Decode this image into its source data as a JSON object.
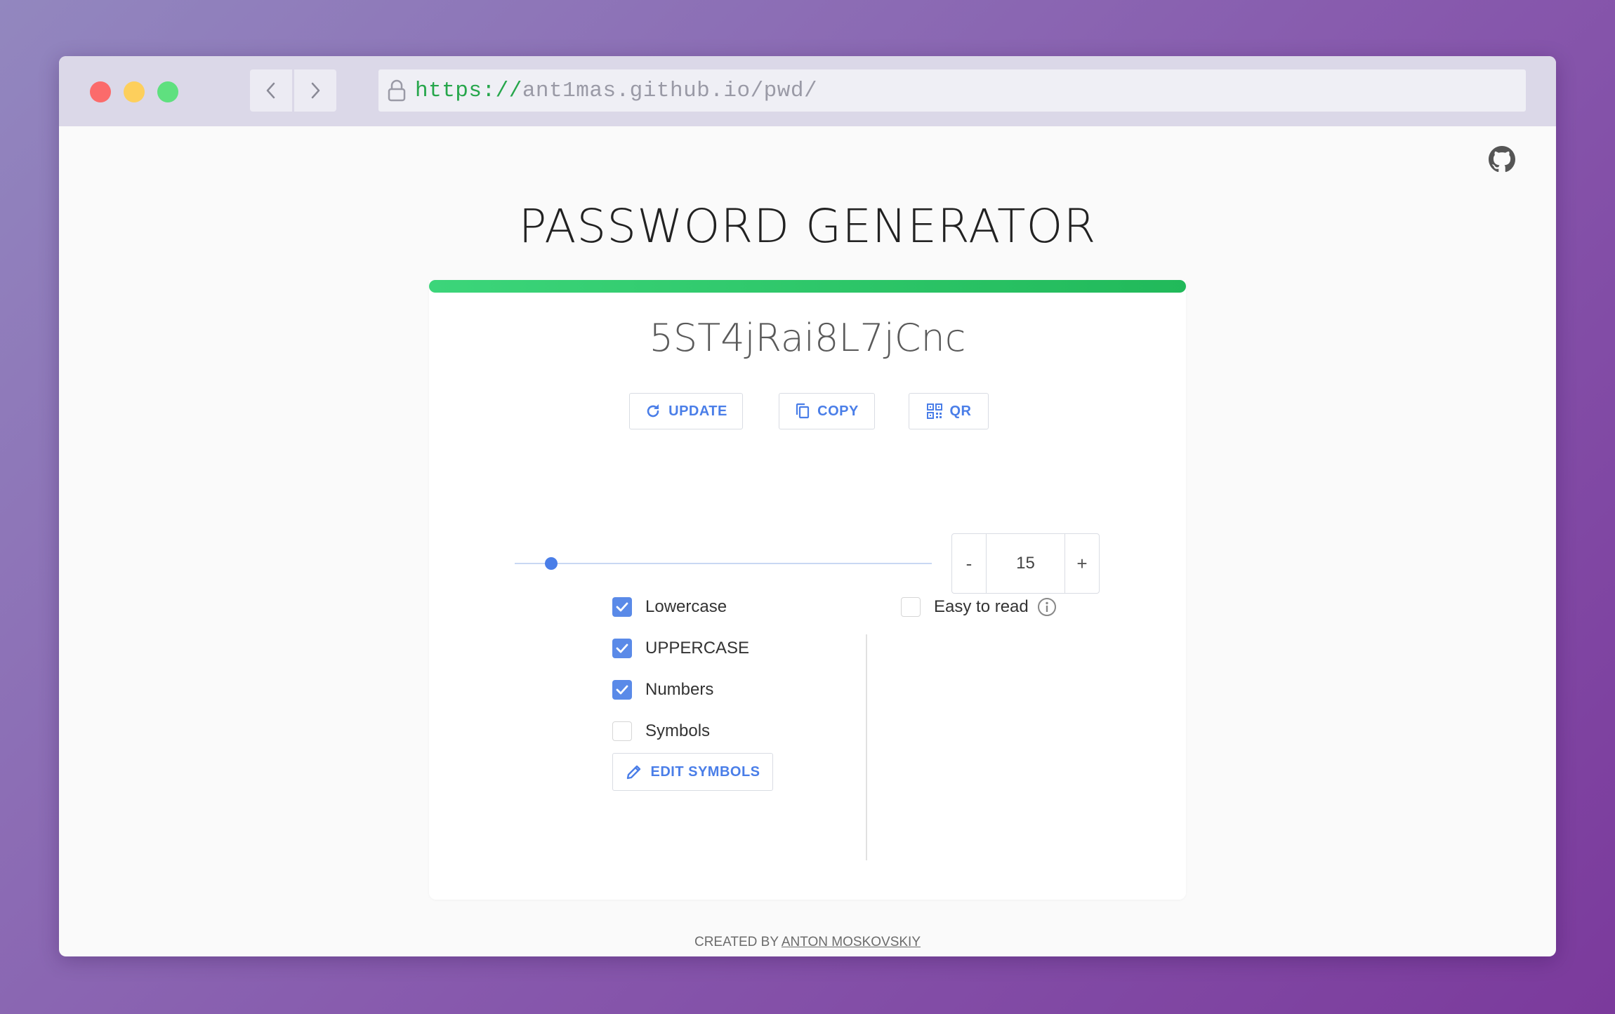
{
  "browser": {
    "url_scheme": "https://",
    "url_host": "ant1mas.github.io/pwd/"
  },
  "page": {
    "title": "PASSWORD GENERATOR",
    "password": "5ST4jRai8L7jCnc",
    "strength_color": "#27c35f",
    "buttons": {
      "update": "UPDATE",
      "copy": "COPY",
      "qr": "QR",
      "edit_symbols": "EDIT SYMBOLS"
    },
    "length": {
      "value": "15",
      "minus": "-",
      "plus": "+"
    },
    "options": {
      "lowercase": {
        "label": "Lowercase",
        "checked": true
      },
      "uppercase": {
        "label": "UPPERCASE",
        "checked": true
      },
      "numbers": {
        "label": "Numbers",
        "checked": true
      },
      "symbols": {
        "label": "Symbols",
        "checked": false
      },
      "easy_to_read": {
        "label": "Easy to read",
        "checked": false
      }
    },
    "footer": {
      "prefix": "CREATED BY ",
      "author": "ANTON MOSKOVSKIY"
    }
  },
  "icons": [
    "lock-icon",
    "chevron-left-icon",
    "chevron-right-icon",
    "github-icon",
    "refresh-icon",
    "copy-icon",
    "qr-code-icon",
    "pencil-icon",
    "info-icon",
    "checkmark-icon"
  ],
  "colors": {
    "accent": "#4a7ee8",
    "checkbox": "#5a8ae8",
    "strength_bar": "#27c35f",
    "url_scheme": "#26a64b"
  }
}
